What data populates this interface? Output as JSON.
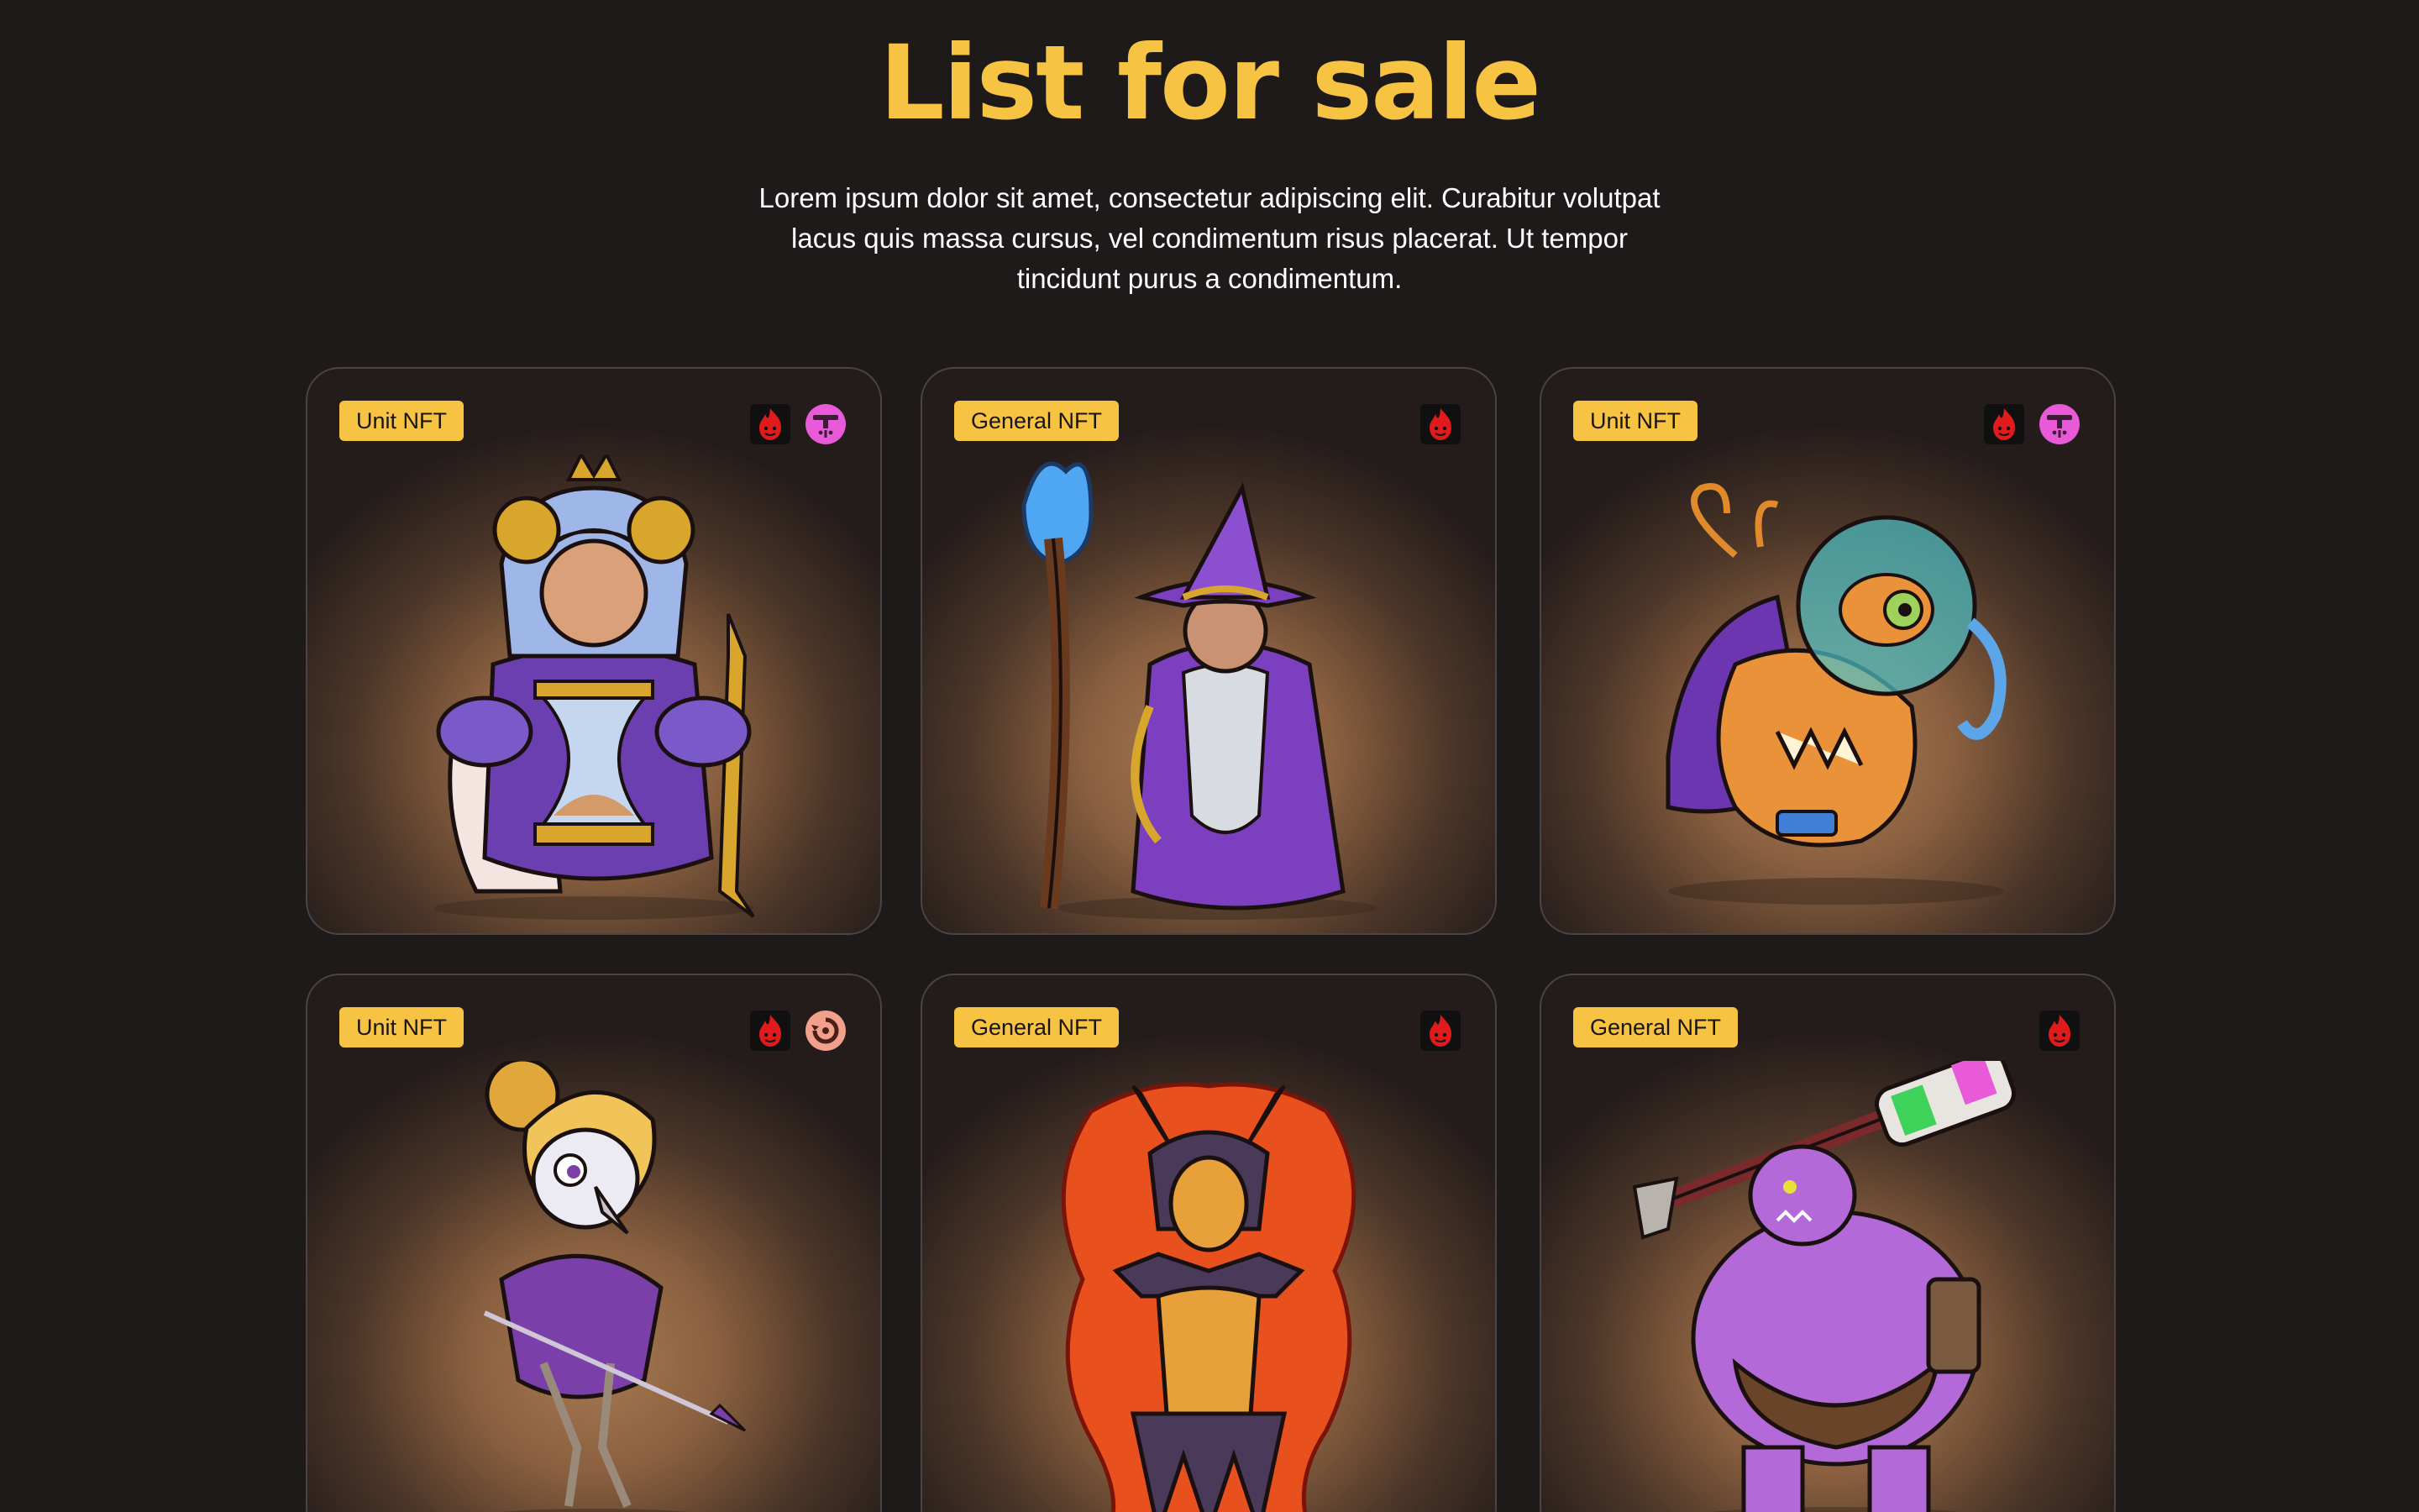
{
  "header": {
    "title": "List for sale",
    "description": "Lorem ipsum dolor sit amet, consectetur adipiscing elit. Curabitur volutpat lacus quis massa cursus, vel condimentum risus placerat. Ut tempor tincidunt purus a condimentum."
  },
  "cards": [
    {
      "badge": "Unit NFT",
      "icons": [
        "fire-element-icon",
        "pink-weapon-class-icon"
      ],
      "character": "time-queen",
      "accent": "#7b4fc9"
    },
    {
      "badge": "General NFT",
      "icons": [
        "fire-element-icon"
      ],
      "character": "wizard",
      "accent": "#8a3fc4"
    },
    {
      "badge": "Unit NFT",
      "icons": [
        "fire-element-icon",
        "pink-weapon-class-icon"
      ],
      "character": "bubble-fish",
      "accent": "#e08a2c"
    },
    {
      "badge": "Unit NFT",
      "icons": [
        "fire-element-icon",
        "salmon-swirl-class-icon"
      ],
      "character": "bird-archer",
      "accent": "#7a3fa8"
    },
    {
      "badge": "General NFT",
      "icons": [
        "fire-element-icon"
      ],
      "character": "fire-demoness",
      "accent": "#e8501e"
    },
    {
      "badge": "General NFT",
      "icons": [
        "fire-element-icon"
      ],
      "character": "ogre-brute",
      "accent": "#b36ad8"
    }
  ],
  "colors": {
    "background": "#1f1a1a",
    "title": "#f6c343",
    "badge": "#f6c343",
    "fire_icon": "#e11b1b",
    "pink_icon": "#e85ad8",
    "salmon_icon": "#f1a08b"
  }
}
